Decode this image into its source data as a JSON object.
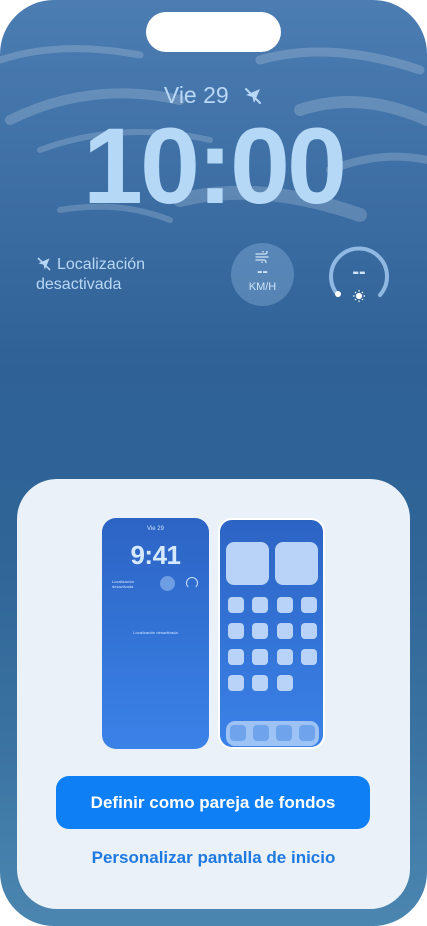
{
  "lock_screen": {
    "date": "Vie 29",
    "time": "10:00",
    "location_line1": "Localización",
    "location_line2": "desactivada",
    "wind_value": "--",
    "wind_unit": "KM/H",
    "gauge_value": "--"
  },
  "preview": {
    "lock": {
      "date": "Vie 29",
      "time": "9:41",
      "location_line1": "Localización",
      "location_line2": "desactivada",
      "location_center": "Localización desactivada"
    }
  },
  "actions": {
    "primary_label": "Definir como pareja de fondos",
    "secondary_label": "Personalizar pantalla de inicio"
  },
  "colors": {
    "accent": "#0f7ff6",
    "link": "#1e7ae0",
    "sheet": "#eaf1f8",
    "lock_text": "#b9d8f6"
  },
  "icons": [
    "location-off-icon",
    "wind-icon",
    "sun-icon"
  ]
}
